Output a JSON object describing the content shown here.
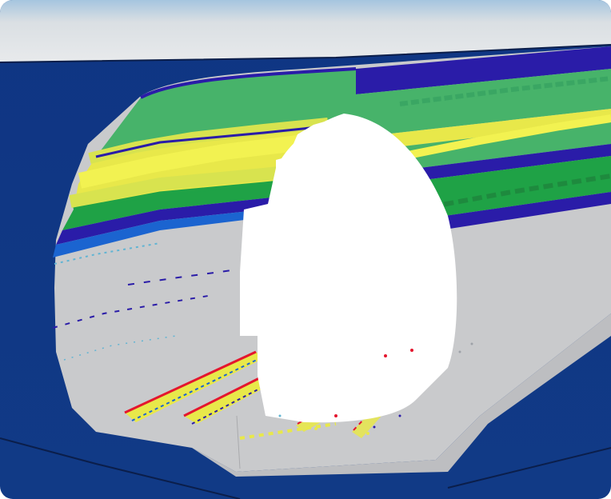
{
  "scene": {
    "title": "",
    "colors": {
      "background_top": "#0F3583",
      "background_bottom": "#113A86",
      "sky_band": "#D8DDE2",
      "tunnel_gray": "#C9CACC",
      "white_void": "#FFFFFF",
      "stripe_navy": "#2A1CA8",
      "stripe_blue": "#1B64D0",
      "stripe_green": "#47B36A",
      "stripe_darkgreen": "#1FA246",
      "stripe_yellow": "#E8E84A",
      "stripe_lime": "#D8E34F",
      "stripe_red": "#E4162E",
      "dot_cyan": "#61B4D3"
    },
    "components": [
      "tunnel-shell",
      "tunnel-inner-surface",
      "color-stripes-left",
      "color-stripes-right",
      "track-rails",
      "occlusion-void"
    ]
  }
}
